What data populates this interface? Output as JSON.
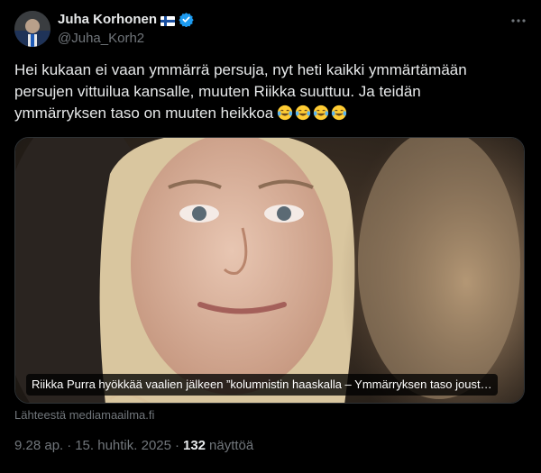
{
  "author": {
    "display_name": "Juha Korhonen",
    "handle": "@Juha_Korh2",
    "flag_icon": "finland-flag-icon",
    "verified_icon": "verified-badge-icon",
    "verified_color": "#1d9bf0"
  },
  "tweet": {
    "text_lines": [
      "Hei kukaan ei vaan ymmärrä persuja, nyt heti kaikki ymmärtämään",
      "persujen vittuilua kansalle, muuten Riikka suuttuu. Ja teidän",
      "ymmärryksen taso on muuten heikkoa"
    ],
    "emojis": [
      "face-with-tears-of-joy",
      "face-with-tears-of-joy",
      "face-with-tears-of-joy",
      "face-with-tears-of-joy"
    ]
  },
  "card": {
    "caption": "Riikka Purra hyökkää vaalien jälkeen ”kolumnistin haaskalla – Ymmärryksen taso joust…",
    "source": "Lähteestä mediamaailma.fi"
  },
  "meta": {
    "time": "9.28 ap.",
    "date": "15. huhtik. 2025",
    "views_count": "132",
    "views_label": "näyttöä",
    "separator": "·"
  }
}
